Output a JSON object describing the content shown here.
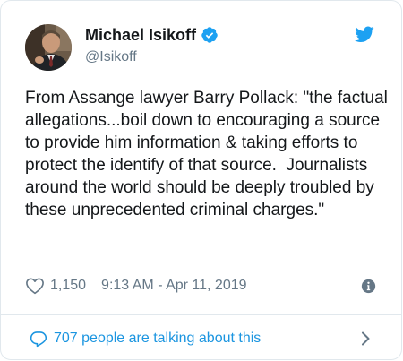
{
  "tweet": {
    "author": {
      "display_name": "Michael Isikoff",
      "handle": "@Isikoff",
      "verified": true,
      "avatar": "profile-photo"
    },
    "text": "From Assange lawyer Barry Pollack: \"the factual allegations...boil down to encouraging a source to provide him information & taking efforts to protect the identify of that source.  Journalists around the world should be deeply troubled by these unprecedented criminal charges.\"",
    "likes": "1,150",
    "timestamp": "9:13 AM - Apr 11, 2019",
    "conversation_label": "707 people are talking about this"
  },
  "icons": {
    "brand": "twitter-bird-icon",
    "verified": "verified-badge-icon",
    "like": "heart-icon",
    "info": "info-icon",
    "reply": "speech-bubble-icon",
    "more": "chevron-right-icon"
  },
  "colors": {
    "brand_blue": "#1da1f2",
    "link_blue": "#1b95e0",
    "text": "#14171a",
    "secondary": "#657786",
    "border": "#e1e8ed"
  }
}
